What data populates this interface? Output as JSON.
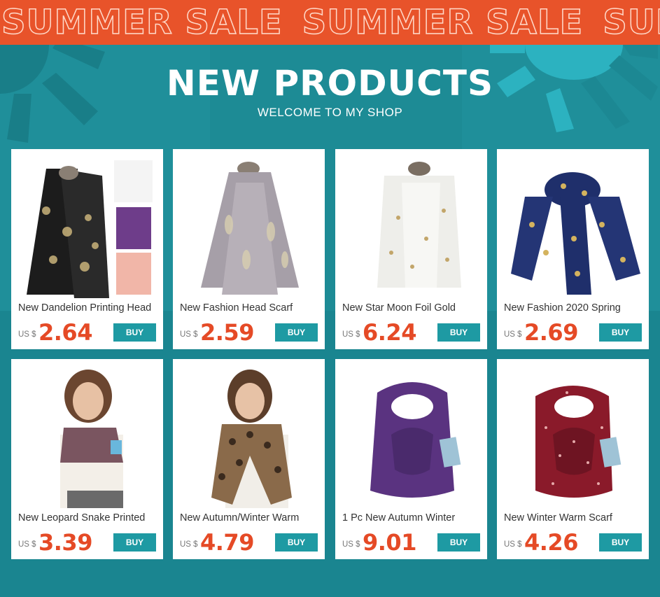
{
  "banner": {
    "repeat_text": [
      "SUMMER SALE",
      "SUMMER SALE",
      "SUMMER SALE"
    ]
  },
  "header": {
    "title": "NEW PRODUCTS",
    "subtitle": "WELCOME TO MY SHOP"
  },
  "colors": {
    "banner": "#e8532a",
    "background": "#1f8f9a",
    "price": "#e54a26",
    "buy_button": "#1e9aa3"
  },
  "products": [
    {
      "name": "New Dandelion Printing Head",
      "currency": "US $",
      "price": "2.64",
      "buy_label": "BUY",
      "image": "black-dandelion-scarf-with-color-variants"
    },
    {
      "name": "New Fashion Head Scarf",
      "currency": "US $",
      "price": "2.59",
      "buy_label": "BUY",
      "image": "grey-feather-foil-scarf"
    },
    {
      "name": "New Star Moon Foil Gold",
      "currency": "US $",
      "price": "6.24",
      "buy_label": "BUY",
      "image": "white-star-moon-scarf"
    },
    {
      "name": "New Fashion 2020 Spring",
      "currency": "US $",
      "price": "2.69",
      "buy_label": "BUY",
      "image": "navy-snowflake-scarf"
    },
    {
      "name": "New Leopard Snake Printed",
      "currency": "US $",
      "price": "3.39",
      "buy_label": "BUY",
      "image": "woman-with-snake-print-scarf"
    },
    {
      "name": "New Autumn/Winter Warm",
      "currency": "US $",
      "price": "4.79",
      "buy_label": "BUY",
      "image": "woman-with-leopard-scarf"
    },
    {
      "name": "1 Pc New Autumn Winter",
      "currency": "US $",
      "price": "9.01",
      "buy_label": "BUY",
      "image": "purple-infinity-scarf-with-pocket"
    },
    {
      "name": "New Winter Warm Scarf",
      "currency": "US $",
      "price": "4.26",
      "buy_label": "BUY",
      "image": "red-sparkle-infinity-scarf"
    }
  ]
}
